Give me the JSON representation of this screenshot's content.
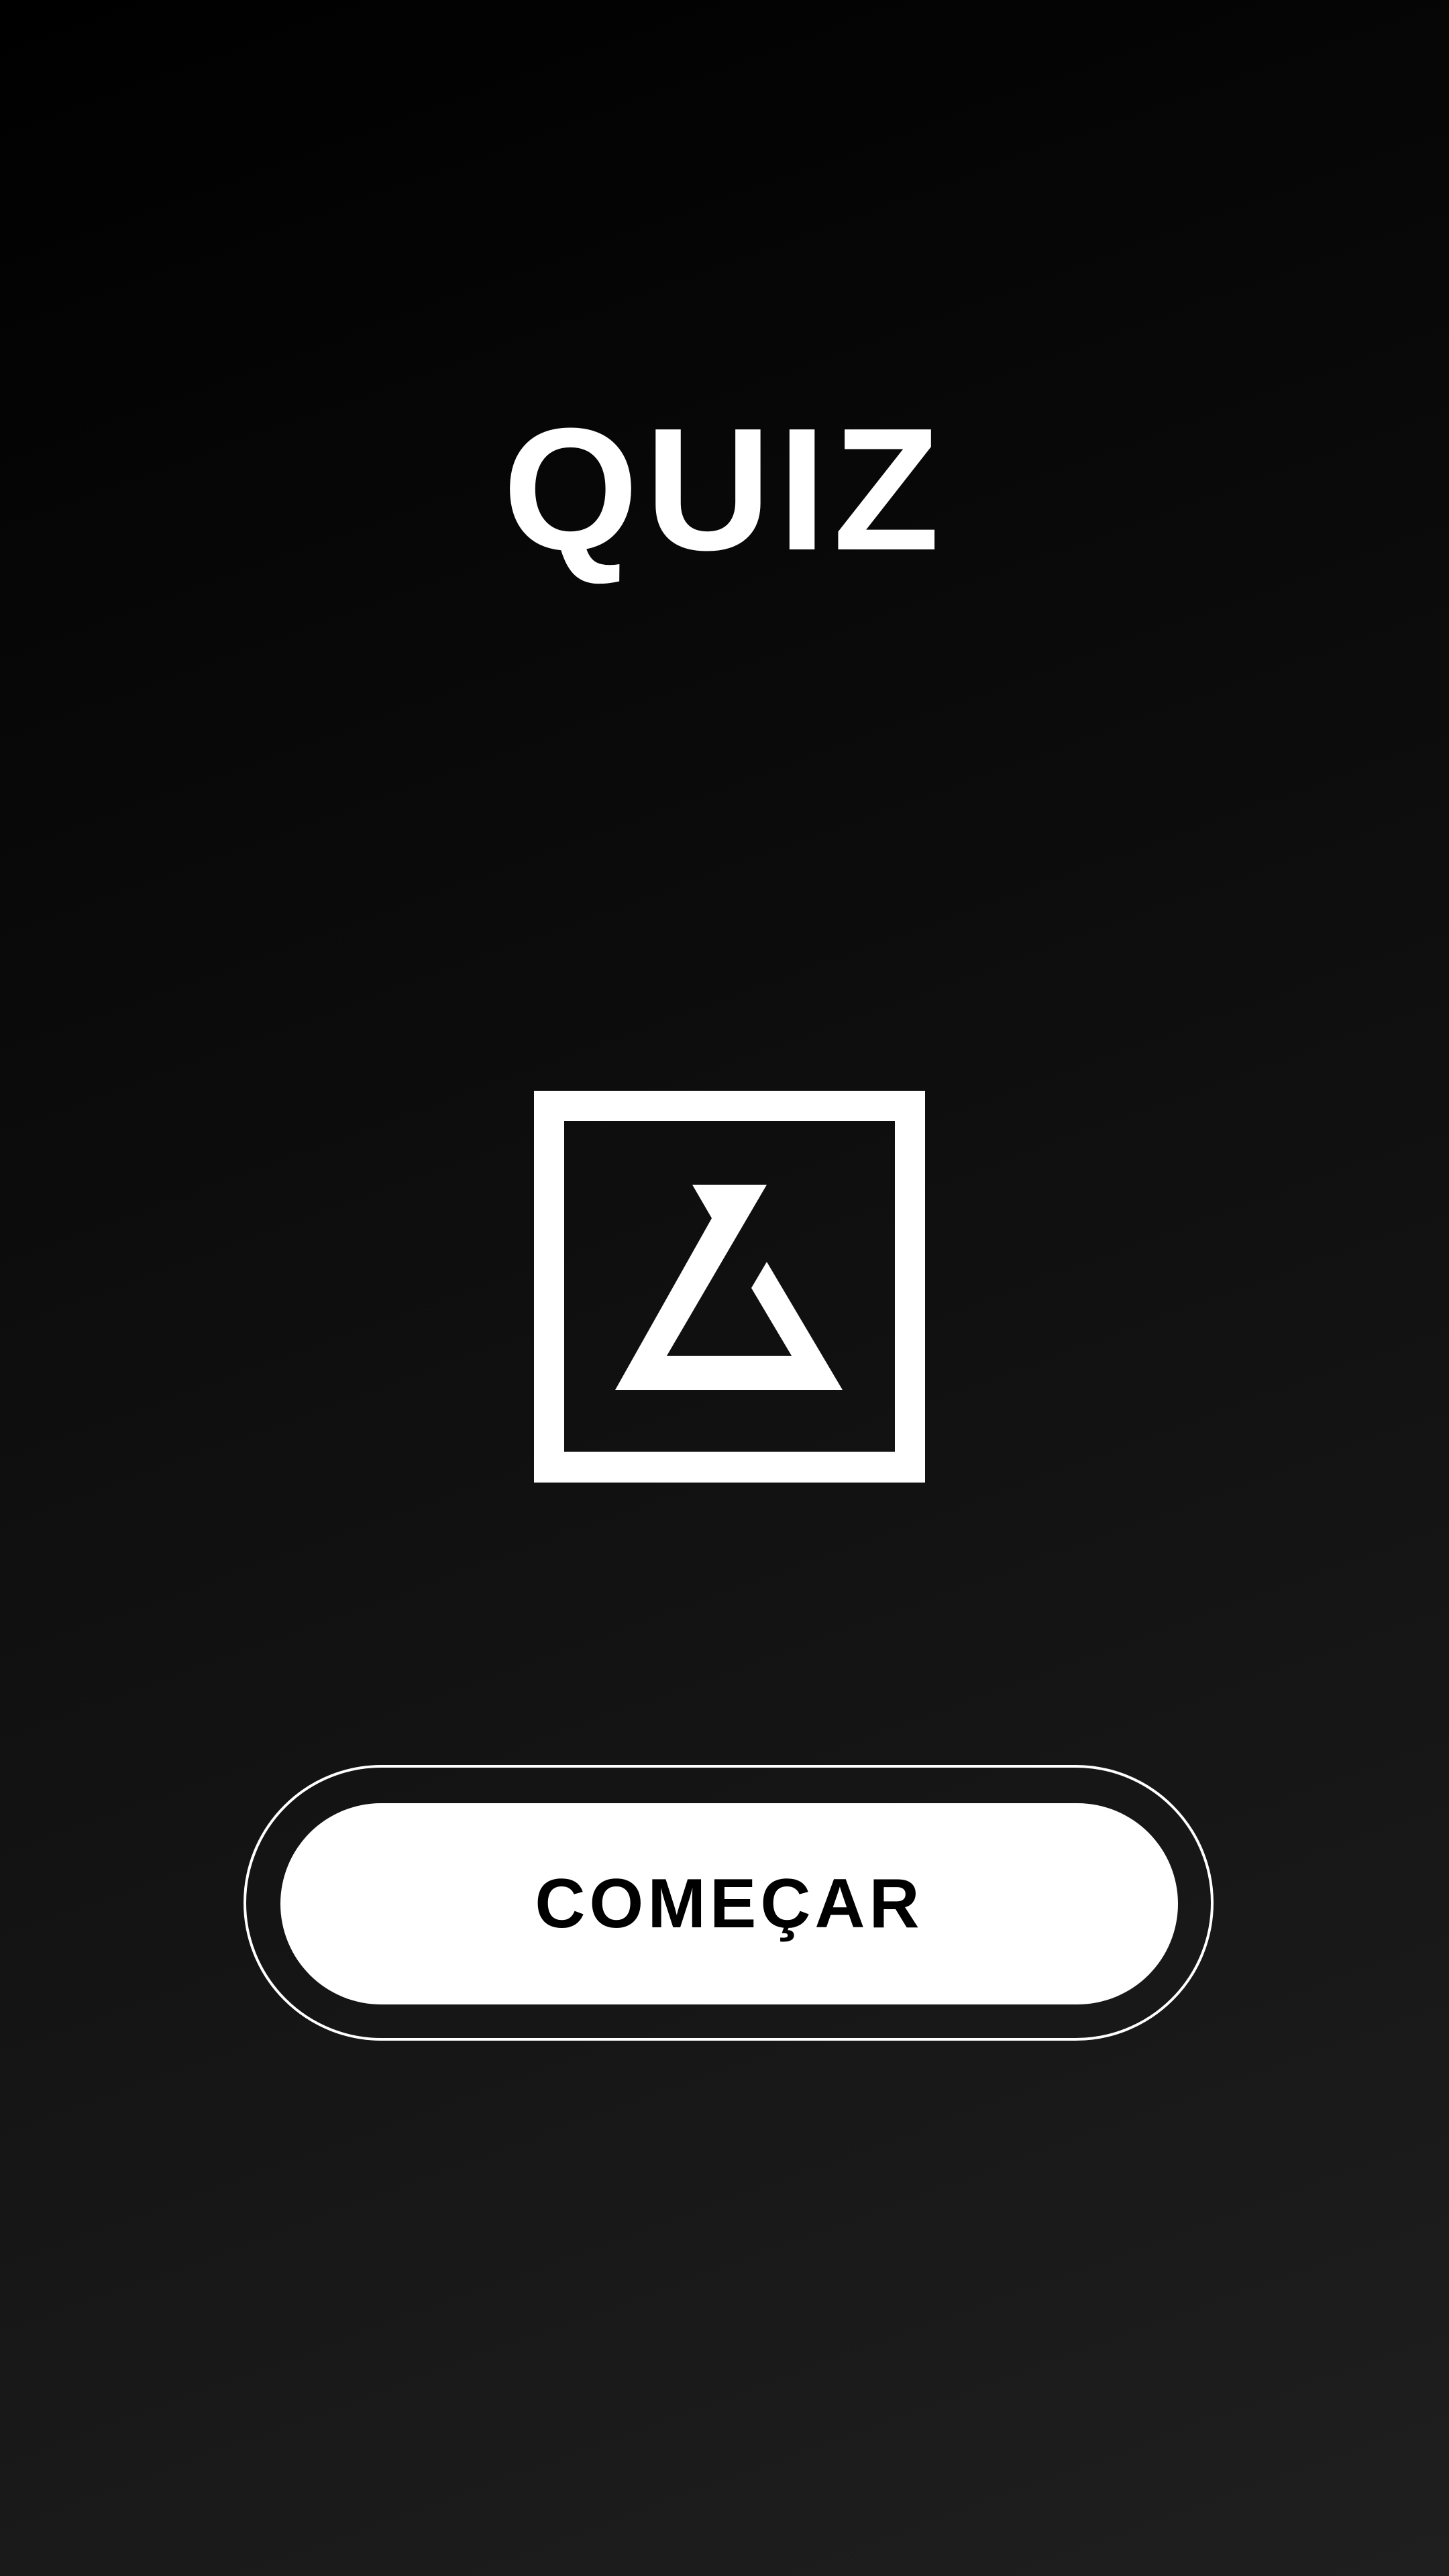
{
  "screen": {
    "title": "QUIZ",
    "start_button_label": "COMEÇAR",
    "logo_icon": "logo-icon"
  },
  "colors": {
    "background_dark": "#000000",
    "background_light": "#1f1f1f",
    "foreground": "#ffffff",
    "button_text": "#000000"
  }
}
